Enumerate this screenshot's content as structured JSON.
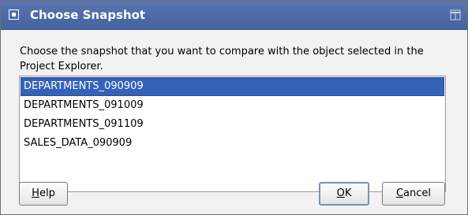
{
  "dialog": {
    "title": "Choose Snapshot",
    "prompt": "Choose the snapshot that you want to compare with the object selected in the Project Explorer.",
    "selected_index": 0,
    "snapshots": [
      "DEPARTMENTS_090909",
      "DEPARTMENTS_091009",
      "DEPARTMENTS_091109",
      "SALES_DATA_090909"
    ],
    "buttons": {
      "help": {
        "mnemonic": "H",
        "rest": "elp"
      },
      "ok": {
        "mnemonic": "O",
        "rest": "K"
      },
      "cancel": {
        "mnemonic": "C",
        "rest": "ancel"
      }
    }
  },
  "colors": {
    "titlebar": "#4d69a6",
    "selection": "#3462b7",
    "background": "#f2f2f2"
  },
  "icons": {
    "window_menu": "window-menu-icon",
    "maximize": "maximize-icon"
  }
}
